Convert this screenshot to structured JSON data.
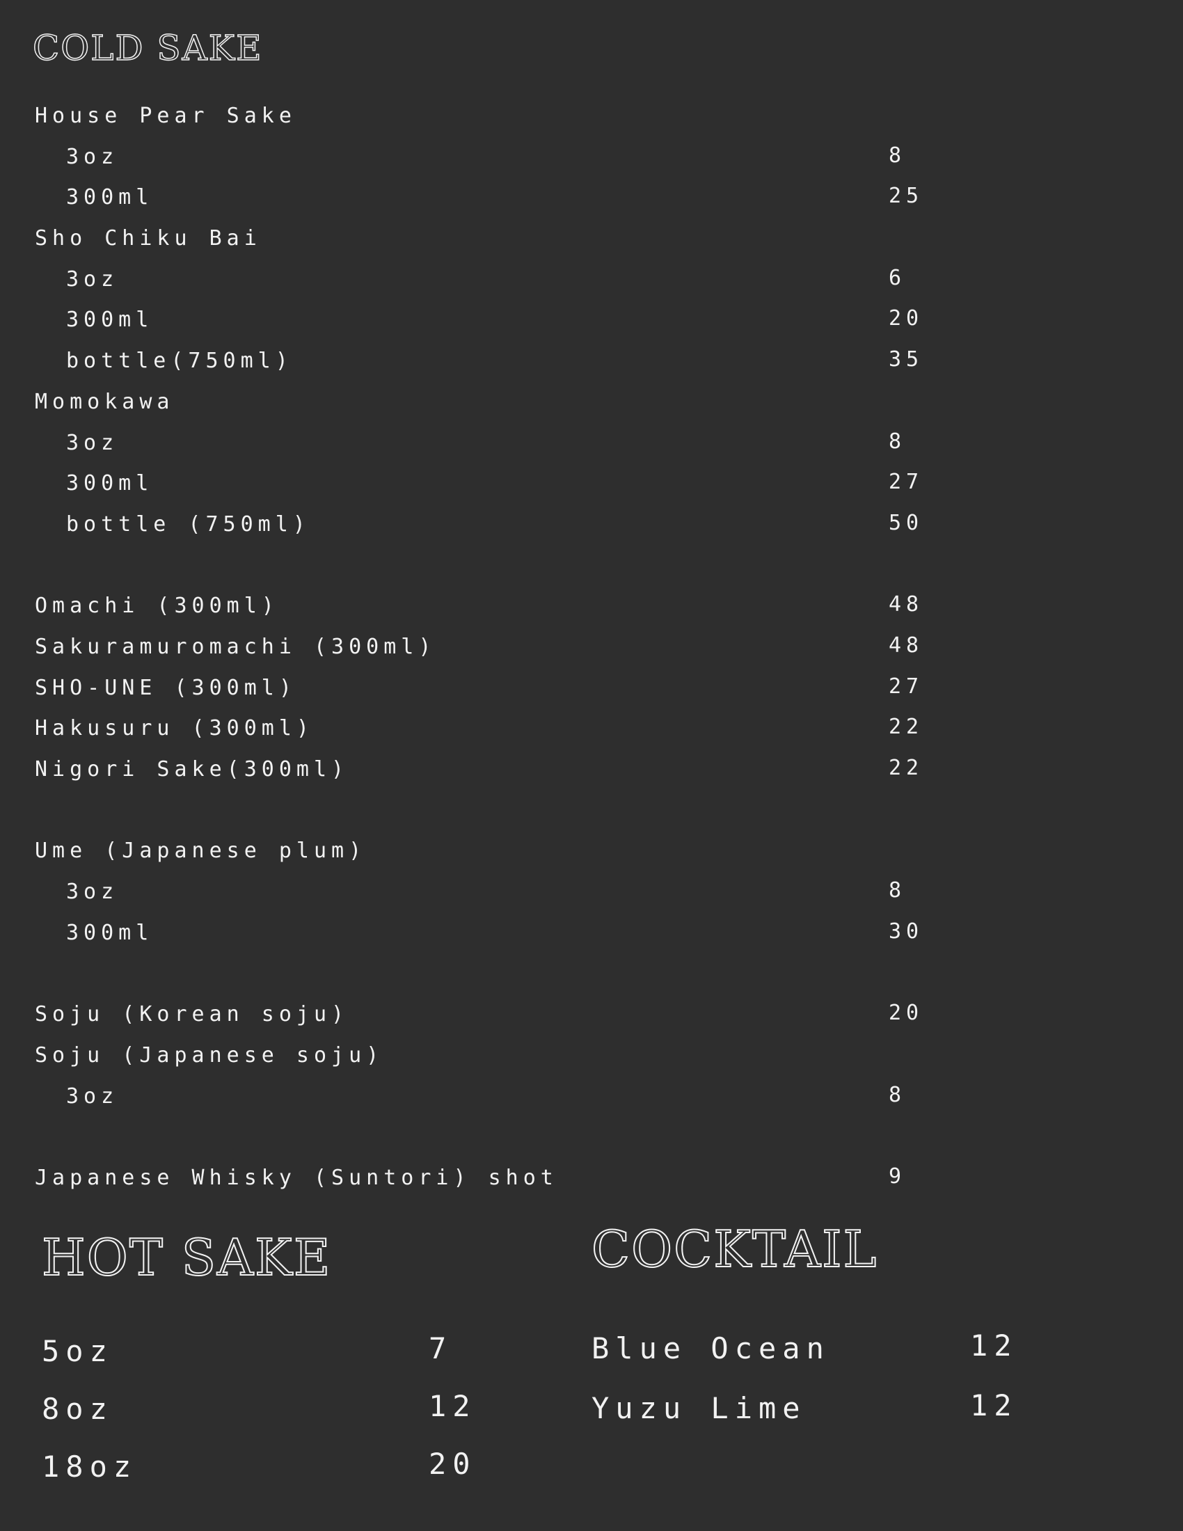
{
  "cold_sake": {
    "title": "COLD SAKE",
    "items": [
      {
        "name": "House Pear Sake",
        "price": "",
        "sub": false
      },
      {
        "name": "3oz",
        "price": "8",
        "sub": true
      },
      {
        "name": "300ml",
        "price": "25",
        "sub": true
      },
      {
        "name": "Sho Chiku Bai",
        "price": "",
        "sub": false
      },
      {
        "name": "3oz",
        "price": "6",
        "sub": true
      },
      {
        "name": "300ml",
        "price": "20",
        "sub": true
      },
      {
        "name": "bottle(750ml)",
        "price": "35",
        "sub": true
      },
      {
        "name": "Momokawa",
        "price": "",
        "sub": false
      },
      {
        "name": "3oz",
        "price": "8",
        "sub": true
      },
      {
        "name": "300ml",
        "price": "27",
        "sub": true
      },
      {
        "name": "bottle (750ml)",
        "price": "50",
        "sub": true
      },
      {
        "name": "Omachi (300ml)",
        "price": "48",
        "sub": false
      },
      {
        "name": "Sakuramuromachi (300ml)",
        "price": "48",
        "sub": false
      },
      {
        "name": "SHO-UNE (300ml)",
        "price": "27",
        "sub": false
      },
      {
        "name": "Hakusuru (300ml)",
        "price": "22",
        "sub": false
      },
      {
        "name": "Nigori Sake(300ml)",
        "price": "22",
        "sub": false
      },
      {
        "name": "Ume (Japanese plum)",
        "price": "",
        "sub": false
      },
      {
        "name": "3oz",
        "price": "8",
        "sub": true
      },
      {
        "name": "300ml",
        "price": "30",
        "sub": true
      },
      {
        "name": "Soju (Korean soju)",
        "price": "20",
        "sub": false
      },
      {
        "name": "Soju (Japanese soju)",
        "price": "",
        "sub": false
      },
      {
        "name": "3oz",
        "price": "8",
        "sub": true
      },
      {
        "name": "Japanese Whisky (Suntori) shot",
        "price": "9",
        "sub": false
      }
    ]
  },
  "hot_sake": {
    "title": "HOT SAKE",
    "items": [
      {
        "name": "5oz",
        "price": "7"
      },
      {
        "name": "8oz",
        "price": "12"
      },
      {
        "name": "18oz",
        "price": "20"
      }
    ]
  },
  "cocktail": {
    "title": "COCKTAIL",
    "items": [
      {
        "name": "Blue Ocean",
        "price": "12"
      },
      {
        "name": "Yuzu Lime",
        "price": "12"
      }
    ]
  },
  "colors": {
    "background": "#2e2e2e",
    "text": "#f2f2f2"
  }
}
